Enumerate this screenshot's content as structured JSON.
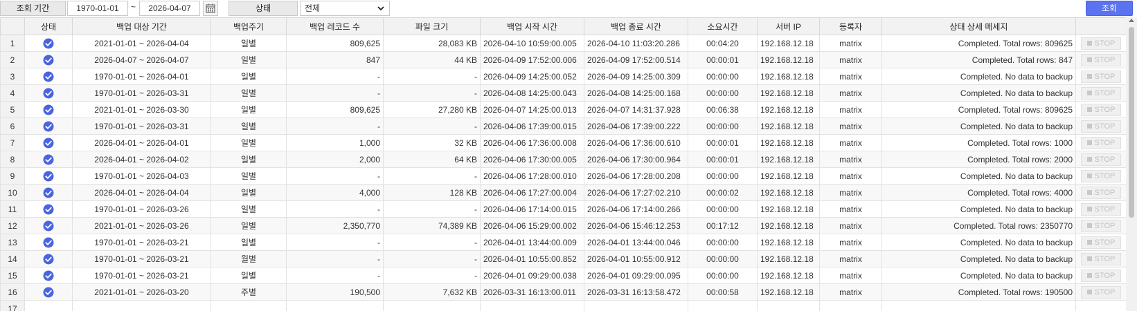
{
  "filter": {
    "period_label": "조회 기간",
    "date_from": "1970-01-01",
    "tilde": "~",
    "date_to": "2026-04-07",
    "status_label": "상태",
    "status_value": "전체",
    "search_label": "조회"
  },
  "table": {
    "headers": [
      "상태",
      "백업 대상 기간",
      "백업주기",
      "백업 레코드 수",
      "파일 크기",
      "백업 시작 시간",
      "백업 종료 시간",
      "소요시간",
      "서버 IP",
      "등록자",
      "상태 상세 메세지",
      ""
    ],
    "stop_label": "STOP",
    "status_color": "#4a63e0",
    "rows": [
      {
        "no": "1",
        "period": "2021-01-01 ~ 2026-04-04",
        "cycle": "일별",
        "records": "809,625",
        "size": "28,083 KB",
        "start": "2026-04-10 10:59:00.005",
        "end": "2026-04-10 11:03:20.286",
        "elapsed": "00:04:20",
        "ip": "192.168.12.18",
        "user": "matrix",
        "message": "Completed. Total rows: 809625"
      },
      {
        "no": "2",
        "period": "2026-04-07 ~ 2026-04-07",
        "cycle": "일별",
        "records": "847",
        "size": "44 KB",
        "start": "2026-04-09 17:52:00.006",
        "end": "2026-04-09 17:52:00.514",
        "elapsed": "00:00:01",
        "ip": "192.168.12.18",
        "user": "matrix",
        "message": "Completed. Total rows: 847"
      },
      {
        "no": "3",
        "period": "1970-01-01 ~ 2026-04-01",
        "cycle": "일별",
        "records": "-",
        "size": "-",
        "start": "2026-04-09 14:25:00.052",
        "end": "2026-04-09 14:25:00.309",
        "elapsed": "00:00:00",
        "ip": "192.168.12.18",
        "user": "matrix",
        "message": "Completed. No data to backup"
      },
      {
        "no": "4",
        "period": "1970-01-01 ~ 2026-03-31",
        "cycle": "일별",
        "records": "-",
        "size": "-",
        "start": "2026-04-08 14:25:00.043",
        "end": "2026-04-08 14:25:00.168",
        "elapsed": "00:00:00",
        "ip": "192.168.12.18",
        "user": "matrix",
        "message": "Completed. No data to backup"
      },
      {
        "no": "5",
        "period": "2021-01-01 ~ 2026-03-30",
        "cycle": "일별",
        "records": "809,625",
        "size": "27,280 KB",
        "start": "2026-04-07 14:25:00.013",
        "end": "2026-04-07 14:31:37.928",
        "elapsed": "00:06:38",
        "ip": "192.168.12.18",
        "user": "matrix",
        "message": "Completed. Total rows: 809625"
      },
      {
        "no": "6",
        "period": "1970-01-01 ~ 2026-03-31",
        "cycle": "일별",
        "records": "-",
        "size": "-",
        "start": "2026-04-06 17:39:00.015",
        "end": "2026-04-06 17:39:00.222",
        "elapsed": "00:00:00",
        "ip": "192.168.12.18",
        "user": "matrix",
        "message": "Completed. No data to backup"
      },
      {
        "no": "7",
        "period": "2026-04-01 ~ 2026-04-01",
        "cycle": "일별",
        "records": "1,000",
        "size": "32 KB",
        "start": "2026-04-06 17:36:00.008",
        "end": "2026-04-06 17:36:00.610",
        "elapsed": "00:00:01",
        "ip": "192.168.12.18",
        "user": "matrix",
        "message": "Completed. Total rows: 1000"
      },
      {
        "no": "8",
        "period": "2026-04-01 ~ 2026-04-02",
        "cycle": "일별",
        "records": "2,000",
        "size": "64 KB",
        "start": "2026-04-06 17:30:00.005",
        "end": "2026-04-06 17:30:00.964",
        "elapsed": "00:00:01",
        "ip": "192.168.12.18",
        "user": "matrix",
        "message": "Completed. Total rows: 2000"
      },
      {
        "no": "9",
        "period": "1970-01-01 ~ 2026-04-03",
        "cycle": "일별",
        "records": "-",
        "size": "-",
        "start": "2026-04-06 17:28:00.010",
        "end": "2026-04-06 17:28:00.208",
        "elapsed": "00:00:00",
        "ip": "192.168.12.18",
        "user": "matrix",
        "message": "Completed. No data to backup"
      },
      {
        "no": "10",
        "period": "2026-04-01 ~ 2026-04-04",
        "cycle": "일별",
        "records": "4,000",
        "size": "128 KB",
        "start": "2026-04-06 17:27:00.004",
        "end": "2026-04-06 17:27:02.210",
        "elapsed": "00:00:02",
        "ip": "192.168.12.18",
        "user": "matrix",
        "message": "Completed. Total rows: 4000"
      },
      {
        "no": "11",
        "period": "1970-01-01 ~ 2026-03-26",
        "cycle": "일별",
        "records": "-",
        "size": "-",
        "start": "2026-04-06 17:14:00.015",
        "end": "2026-04-06 17:14:00.266",
        "elapsed": "00:00:00",
        "ip": "192.168.12.18",
        "user": "matrix",
        "message": "Completed. No data to backup"
      },
      {
        "no": "12",
        "period": "2021-01-01 ~ 2026-03-26",
        "cycle": "일별",
        "records": "2,350,770",
        "size": "74,389 KB",
        "start": "2026-04-06 15:29:00.002",
        "end": "2026-04-06 15:46:12.253",
        "elapsed": "00:17:12",
        "ip": "192.168.12.18",
        "user": "matrix",
        "message": "Completed. Total rows: 2350770"
      },
      {
        "no": "13",
        "period": "1970-01-01 ~ 2026-03-21",
        "cycle": "일별",
        "records": "-",
        "size": "-",
        "start": "2026-04-01 13:44:00.009",
        "end": "2026-04-01 13:44:00.046",
        "elapsed": "00:00:00",
        "ip": "192.168.12.18",
        "user": "matrix",
        "message": "Completed. No data to backup"
      },
      {
        "no": "14",
        "period": "1970-01-01 ~ 2026-03-21",
        "cycle": "월별",
        "records": "-",
        "size": "-",
        "start": "2026-04-01 10:55:00.852",
        "end": "2026-04-01 10:55:00.912",
        "elapsed": "00:00:00",
        "ip": "192.168.12.18",
        "user": "matrix",
        "message": "Completed. No data to backup"
      },
      {
        "no": "15",
        "period": "1970-01-01 ~ 2026-03-21",
        "cycle": "일별",
        "records": "-",
        "size": "-",
        "start": "2026-04-01 09:29:00.038",
        "end": "2026-04-01 09:29:00.095",
        "elapsed": "00:00:00",
        "ip": "192.168.12.18",
        "user": "matrix",
        "message": "Completed. No data to backup"
      },
      {
        "no": "16",
        "period": "2021-01-01 ~ 2026-03-20",
        "cycle": "주별",
        "records": "190,500",
        "size": "7,632 KB",
        "start": "2026-03-31 16:13:00.011",
        "end": "2026-03-31 16:13:58.472",
        "elapsed": "00:00:58",
        "ip": "192.168.12.18",
        "user": "matrix",
        "message": "Completed. Total rows: 190500"
      },
      {
        "no": "17",
        "period": "",
        "cycle": "",
        "records": "",
        "size": "",
        "start": "",
        "end": "",
        "elapsed": "",
        "ip": "",
        "user": "",
        "message": ""
      }
    ]
  }
}
